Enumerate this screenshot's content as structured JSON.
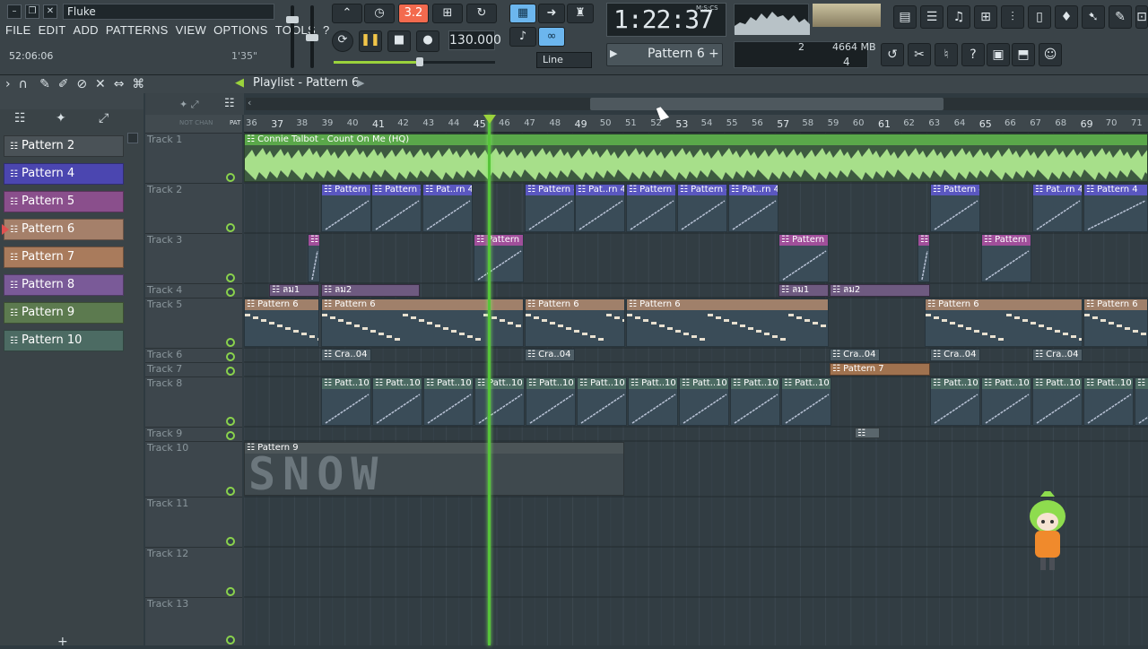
{
  "window": {
    "title": "Fluke",
    "hint_left": "52:06:06",
    "hint_right": "1'35\""
  },
  "menu": [
    "FILE",
    "EDIT",
    "ADD",
    "PATTERNS",
    "VIEW",
    "OPTIONS",
    "TOOLS",
    "?"
  ],
  "transport": {
    "tempo": "130.000",
    "time": "1:22:37",
    "time_unit": "M:S:CS",
    "pattern": "Pattern 6",
    "snap": "Line",
    "step_toggle": "3.2"
  },
  "system": {
    "mem_a": "2",
    "mem_b": "4664 MB",
    "poly": "4"
  },
  "playlist": {
    "title": "Playlist - Pattern 6",
    "ruler_hdr": "PAT"
  },
  "patterns": [
    {
      "label": "Pattern 2",
      "color": "#4a5257"
    },
    {
      "label": "Pattern 4",
      "color": "#4b46b0"
    },
    {
      "label": "Pattern 5",
      "color": "#8a4f8c"
    },
    {
      "label": "Pattern 6",
      "color": "#a5806a"
    },
    {
      "label": "Pattern 7",
      "color": "#a97b5c"
    },
    {
      "label": "Pattern 8",
      "color": "#7a5a98"
    },
    {
      "label": "Pattern 9",
      "color": "#5c7a4f"
    },
    {
      "label": "Pattern 10",
      "color": "#4c6b63"
    }
  ],
  "ruler": [
    "36",
    "37",
    "38",
    "39",
    "40",
    "41",
    "42",
    "43",
    "44",
    "45",
    "46",
    "47",
    "48",
    "49",
    "50",
    "51",
    "52",
    "53",
    "54",
    "55",
    "56",
    "57",
    "58",
    "59",
    "60",
    "61",
    "62",
    "63",
    "64",
    "65",
    "66",
    "67",
    "68",
    "69",
    "70",
    "71"
  ],
  "tracks": [
    "Track 1",
    "Track 2",
    "Track 3",
    "Track 4",
    "Track 5",
    "Track 6",
    "Track 7",
    "Track 8",
    "Track 9",
    "Track 10",
    "Track 11",
    "Track 12",
    "Track 13"
  ],
  "clips": {
    "audio": "Connie Talbot - Count On Me (HQ)",
    "p4": "Pattern 4",
    "p4s": "Pat..rn 4",
    "p5": "Pattern 5",
    "seg1": "ลม1",
    "seg2": "ลม2",
    "p6": "Pattern 6",
    "cra": "Cra..04",
    "p7": "Pattern 7",
    "p10": "Patt..10",
    "p9": "Pattern 9"
  }
}
